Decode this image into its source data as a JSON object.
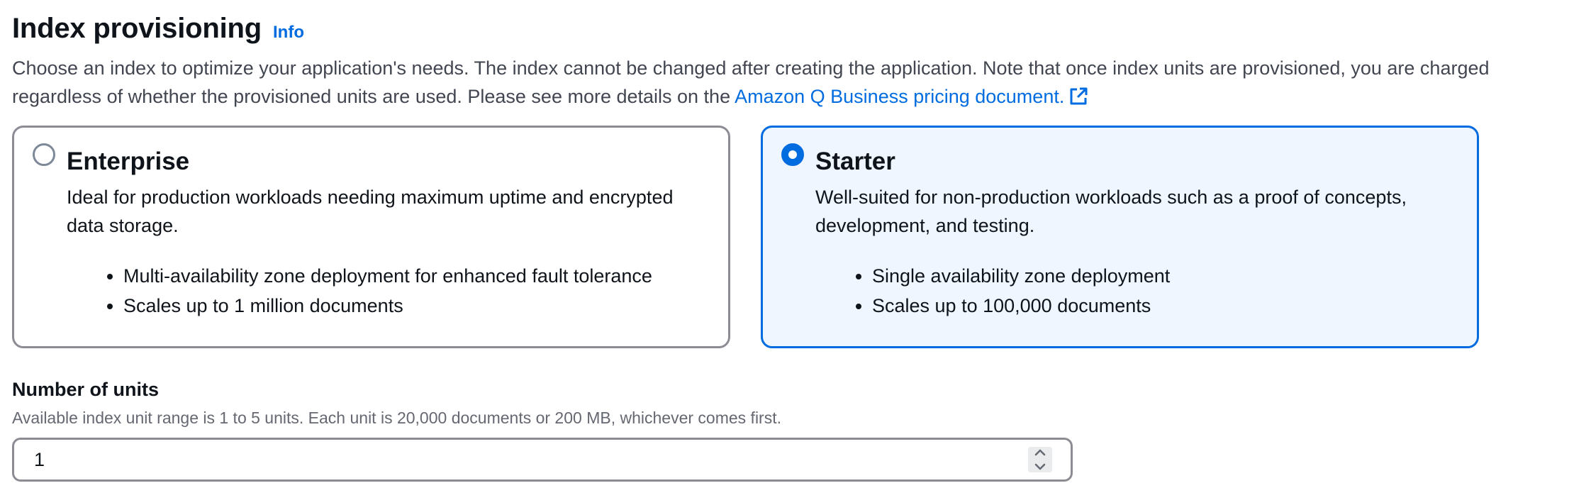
{
  "header": {
    "title": "Index provisioning",
    "info_label": "Info"
  },
  "description": {
    "text": "Choose an index to optimize your application's needs. The index cannot be changed after creating the application. Note that once index units are provisioned, you are charged regardless of whether the provisioned units are used. Please see more details on the ",
    "link_text": "Amazon Q Business pricing document.",
    "link_icon": "external-link-icon"
  },
  "tiles": [
    {
      "title": "Enterprise",
      "description": "Ideal for production workloads needing maximum uptime and encrypted data storage.",
      "bullets": [
        "Multi-availability zone deployment for enhanced fault tolerance",
        "Scales up to 1 million documents"
      ],
      "selected": false
    },
    {
      "title": "Starter",
      "description": "Well-suited for non-production workloads such as a proof of concepts, development, and testing.",
      "bullets": [
        "Single availability zone deployment",
        "Scales up to 100,000 documents"
      ],
      "selected": true
    }
  ],
  "units": {
    "label": "Number of units",
    "hint": "Available index unit range is 1 to 5 units. Each unit is 20,000 documents or 200 MB, whichever comes first.",
    "value": "1",
    "stepper_icons": [
      "chevron-up-icon",
      "chevron-down-icon"
    ]
  },
  "colors": {
    "link": "#006ce0",
    "selected_border": "#006ce0",
    "selected_background": "#f0f6ff",
    "unselected_border": "#8c8c94",
    "text_primary": "#0f141a",
    "text_secondary": "#424650",
    "text_hint": "#656871"
  }
}
